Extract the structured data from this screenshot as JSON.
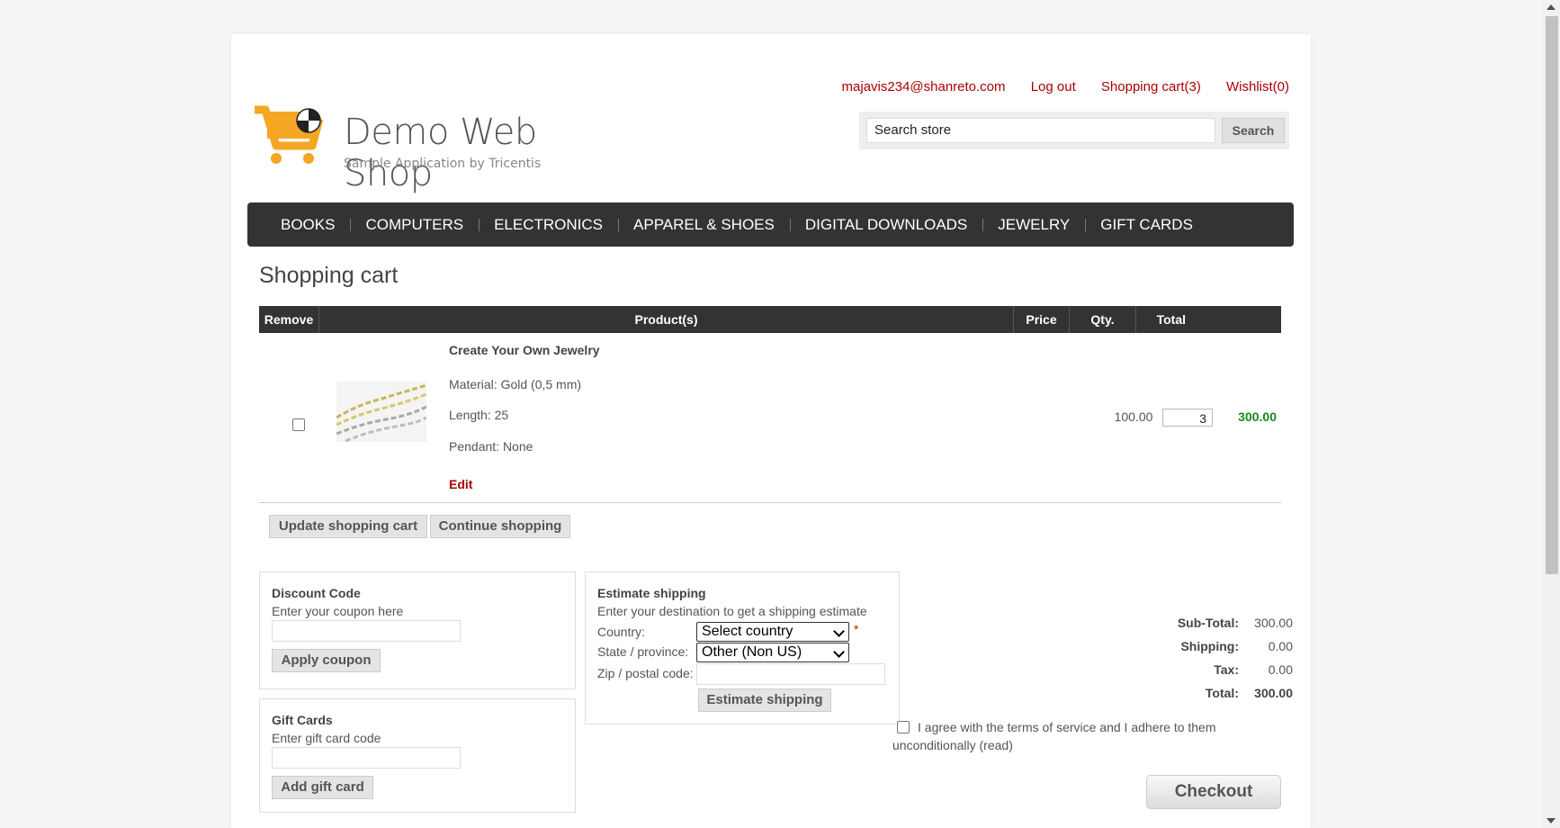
{
  "header": {
    "logo_title": "Demo Web Shop",
    "logo_subtitle": "Sample Application by Tricentis",
    "links": {
      "account": "majavis234@shanreto.com",
      "logout": "Log out",
      "cart": "Shopping cart(3)",
      "wishlist": "Wishlist(0)"
    },
    "search": {
      "value": "Search store",
      "button": "Search"
    }
  },
  "nav": [
    "BOOKS",
    "COMPUTERS",
    "ELECTRONICS",
    "APPAREL & SHOES",
    "DIGITAL DOWNLOADS",
    "JEWELRY",
    "GIFT CARDS"
  ],
  "page_title": "Shopping cart",
  "cart": {
    "columns": {
      "remove": "Remove",
      "product": "Product(s)",
      "price": "Price",
      "qty": "Qty.",
      "total": "Total"
    },
    "items": [
      {
        "name": "Create Your Own Jewelry",
        "attributes": [
          "Material: Gold (0,5 mm)",
          "Length: 25",
          "Pendant: None"
        ],
        "edit": "Edit",
        "price": "100.00",
        "qty": "3",
        "total": "300.00"
      }
    ],
    "buttons": {
      "update": "Update shopping cart",
      "continue": "Continue shopping"
    }
  },
  "discount": {
    "title": "Discount Code",
    "hint": "Enter your coupon here",
    "button": "Apply coupon"
  },
  "giftcard": {
    "title": "Gift Cards",
    "hint": "Enter gift card code",
    "button": "Add gift card"
  },
  "shipping": {
    "title": "Estimate shipping",
    "hint": "Enter your destination to get a shipping estimate",
    "country_label": "Country:",
    "country_value": "Select country",
    "state_label": "State / province:",
    "state_value": "Other (Non US)",
    "zip_label": "Zip / postal code:",
    "button": "Estimate shipping",
    "required_mark": "*"
  },
  "totals": {
    "subtotal_label": "Sub-Total:",
    "subtotal": "300.00",
    "shipping_label": "Shipping:",
    "shipping": "0.00",
    "tax_label": "Tax:",
    "tax": "0.00",
    "total_label": "Total:",
    "total": "300.00"
  },
  "terms": {
    "text": "I agree with the terms of service and I adhere to them unconditionally",
    "link": "(read)"
  },
  "checkout": "Checkout",
  "colors": {
    "link": "#aa0000",
    "nav_bg": "#333333",
    "total_green": "#18891c"
  }
}
